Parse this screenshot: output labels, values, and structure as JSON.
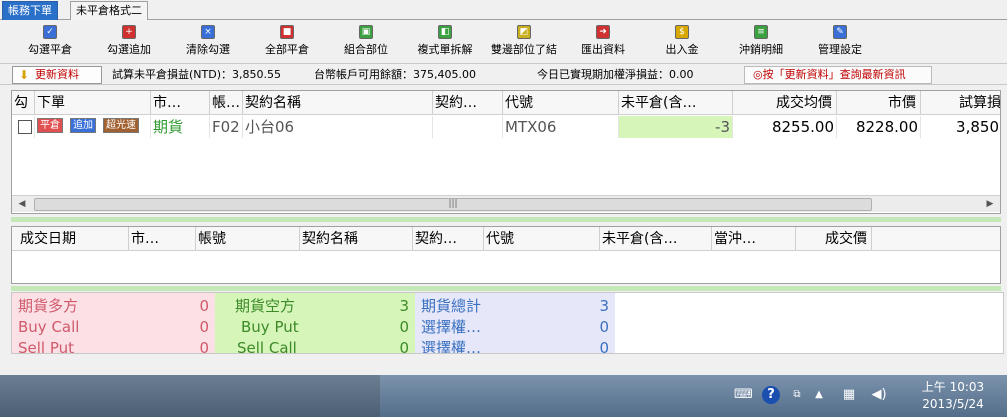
{
  "tabs": [
    {
      "label": "帳務下單",
      "active": true
    },
    {
      "label": "未平倉格式二",
      "active": false
    }
  ],
  "toolbar": {
    "buttons": [
      {
        "label": "勾選平倉",
        "icon": "checklist-close-icon",
        "color": "#3a6fd8"
      },
      {
        "label": "勾選追加",
        "icon": "checklist-add-icon",
        "color": "#d03030"
      },
      {
        "label": "清除勾選",
        "icon": "clear-check-icon",
        "color": "#3a6fd8"
      },
      {
        "label": "全部平倉",
        "icon": "close-all-icon",
        "color": "#d03030"
      },
      {
        "label": "組合部位",
        "icon": "combine-position-icon",
        "color": "#3aa040"
      },
      {
        "label": "複式單拆解",
        "icon": "split-order-icon",
        "color": "#3aa040"
      },
      {
        "label": "雙邊部位了結",
        "icon": "settle-both-icon",
        "color": "#c8b020"
      },
      {
        "label": "匯出資料",
        "icon": "export-data-icon",
        "color": "#d03030"
      },
      {
        "label": "出入金",
        "icon": "money-transfer-icon",
        "color": "#d8a800"
      },
      {
        "label": "沖銷明細",
        "icon": "offset-detail-icon",
        "color": "#3aa040"
      },
      {
        "label": "管理設定",
        "icon": "settings-icon",
        "color": "#3a6fd8"
      }
    ]
  },
  "status": {
    "refresh_label": "更新資料",
    "unrealized_pl": "試算未平倉損益(NTD)：3,850.55",
    "available_balance": "台幣帳戶可用餘額：375,405.00",
    "realized_today": "今日已實現期加權淨損益：0.00",
    "hint": "◎按「更新資料」查詢最新資訊"
  },
  "positions": {
    "headers": [
      "勾",
      "下單",
      "市…",
      "帳…",
      "契約名稱",
      "契約…",
      "代號",
      "未平倉(含…",
      "成交均價",
      "市價",
      "試算損"
    ],
    "rows": [
      {
        "btn_close": "平倉",
        "btn_add": "追加",
        "btn_fast": "超光速",
        "market": "期貨",
        "account": "F02",
        "contract_name": "小台06",
        "contract_month": "",
        "code": "MTX06",
        "open_qty": "-3",
        "avg_price": "8255.00",
        "market_price": "8228.00",
        "pl": "3,850"
      }
    ]
  },
  "trades": {
    "headers": [
      "成交日期",
      "市…",
      "帳號",
      "契約名稱",
      "契約…",
      "代號",
      "未平倉(含…",
      "當沖…",
      "成交價"
    ]
  },
  "summary": {
    "pink": [
      [
        "期貨多方",
        "0"
      ],
      [
        "Buy Call",
        "0"
      ],
      [
        "Sell Put",
        "0"
      ]
    ],
    "green": [
      [
        "期貨空方",
        "3"
      ],
      [
        "Buy Put",
        "0"
      ],
      [
        "Sell Call",
        "0"
      ]
    ],
    "blue": [
      [
        "期貨總計",
        "3"
      ],
      [
        "選擇權…",
        "0"
      ],
      [
        "選擇權…",
        "0"
      ]
    ]
  },
  "taskbar": {
    "time": "上午 10:03",
    "date": "2013/5/24"
  }
}
